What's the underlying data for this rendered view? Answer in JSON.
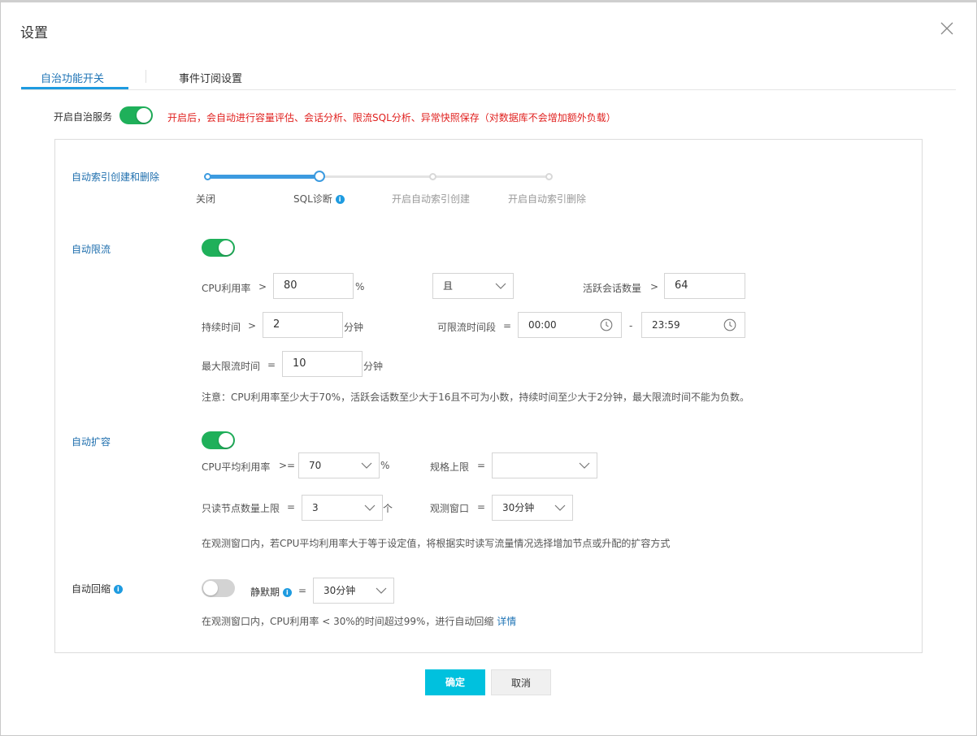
{
  "dialog": {
    "title": "设置"
  },
  "tabs": [
    {
      "label": "自治功能开关",
      "active": true
    },
    {
      "label": "事件订阅设置",
      "active": false
    }
  ],
  "autonomy": {
    "label": "开启自治服务",
    "enabled": true,
    "warning": "开启后，会自动进行容量评估、会话分析、限流SQL分析、异常快照保存（对数据库不会增加额外负载）"
  },
  "auto_index": {
    "label": "自动索引创建和删除",
    "steps": [
      "关闭",
      "SQL诊断",
      "开启自动索引创建",
      "开启自动索引删除"
    ],
    "selected_index": 1
  },
  "auto_throttle": {
    "label": "自动限流",
    "enabled": true,
    "cpu_label": "CPU利用率",
    "cpu_op": ">",
    "cpu_value": "80",
    "cpu_unit": "%",
    "logic_value": "且",
    "sessions_label": "活跃会话数量",
    "sessions_op": ">",
    "sessions_value": "64",
    "duration_label": "持续时间",
    "duration_op": ">",
    "duration_value": "2",
    "duration_unit": "分钟",
    "window_label": "可限流时间段",
    "window_op": "=",
    "window_start": "00:00",
    "window_dash": "-",
    "window_end": "23:59",
    "max_label": "最大限流时间",
    "max_op": "=",
    "max_value": "10",
    "max_unit": "分钟",
    "note": "注意：CPU利用率至少大于70%，活跃会话数至少大于16且不可为小数，持续时间至少大于2分钟，最大限流时间不能为负数。"
  },
  "auto_scale": {
    "label": "自动扩容",
    "enabled": true,
    "cpu_avg_label": "CPU平均利用率",
    "cpu_avg_op": ">=",
    "cpu_avg_value": "70",
    "cpu_avg_unit": "%",
    "spec_label": "规格上限",
    "spec_op": "=",
    "spec_value": "",
    "ro_label": "只读节点数量上限",
    "ro_op": "=",
    "ro_value": "3",
    "ro_unit": "个",
    "obs_label": "观测窗口",
    "obs_op": "=",
    "obs_value": "30分钟",
    "note": "在观测窗口内，若CPU平均利用率大于等于设定值，将根据实时读写流量情况选择增加节点或升配的扩容方式"
  },
  "auto_shrink": {
    "label": "自动回缩",
    "enabled": false,
    "quiet_label": "静默期",
    "quiet_op": "=",
    "quiet_value": "30分钟",
    "note": "在观测窗口内，CPU利用率 < 30%的时间超过99%，进行自动回缩",
    "detail_link": "详情"
  },
  "footer": {
    "ok": "确定",
    "cancel": "取消"
  },
  "colors": {
    "accent": "#1e9be0",
    "toggle_on": "#1fb05a",
    "warning": "#e0211f",
    "primary_button": "#00c1de"
  }
}
